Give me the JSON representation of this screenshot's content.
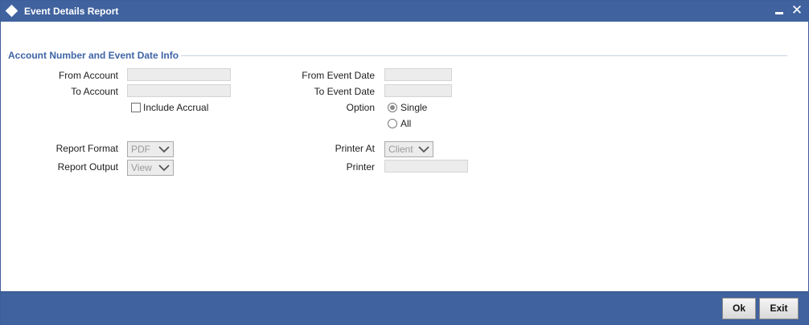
{
  "window": {
    "title": "Event Details Report",
    "close_glyph": "✕"
  },
  "section": {
    "title": "Account Number and Event Date Info"
  },
  "form": {
    "from_account_label": "From Account",
    "from_account_value": "",
    "to_account_label": "To Account",
    "to_account_value": "",
    "include_accrual_label": "Include Accrual",
    "include_accrual_checked": false,
    "from_event_date_label": "From Event Date",
    "from_event_date_value": "",
    "to_event_date_label": "To Event Date",
    "to_event_date_value": "",
    "option_label": "Option",
    "option_single_label": "Single",
    "option_all_label": "All",
    "option_selected": "Single",
    "report_format_label": "Report Format",
    "report_format_value": "PDF",
    "report_output_label": "Report Output",
    "report_output_value": "View",
    "printer_at_label": "Printer At",
    "printer_at_value": "Client",
    "printer_label": "Printer",
    "printer_value": ""
  },
  "footer": {
    "ok_label": "Ok",
    "exit_label": "Exit"
  },
  "colors": {
    "titlebar": "#40629e",
    "section_title": "#3f64a6",
    "footer": "#40629e"
  },
  "icons": {
    "title": "diamond-icon",
    "minimize": "minimize-icon",
    "close": "close-icon",
    "dropdown": "chevron-down-icon"
  }
}
